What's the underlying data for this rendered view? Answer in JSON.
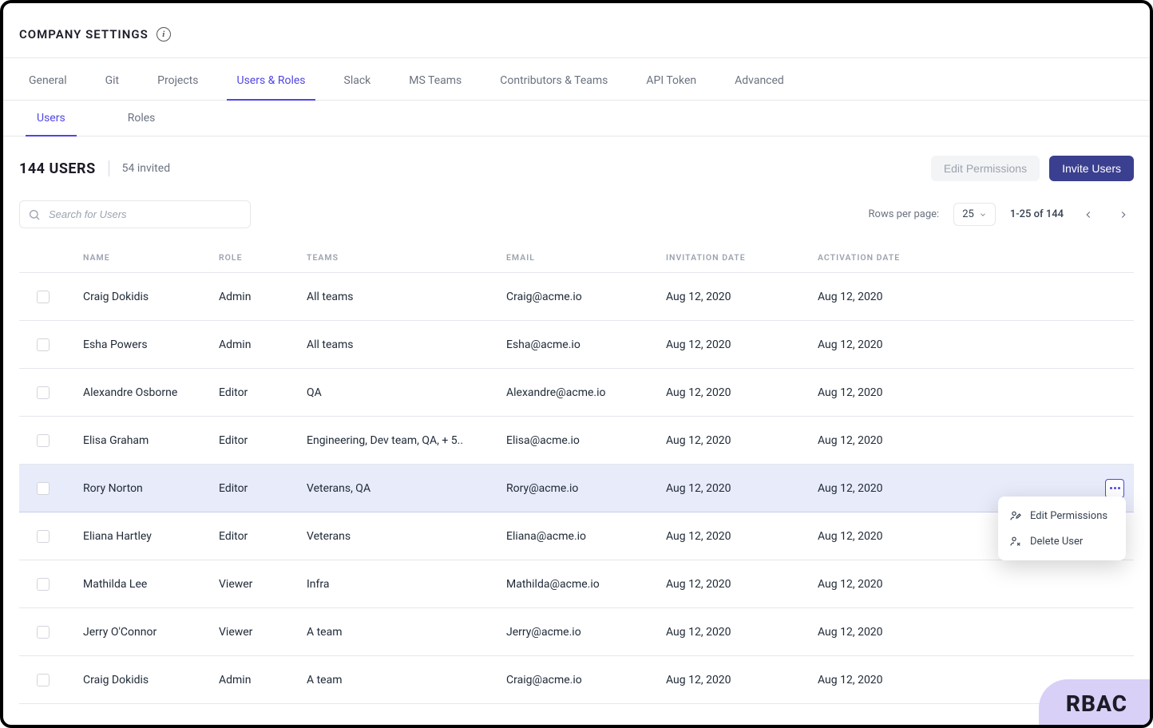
{
  "header": {
    "title": "COMPANY SETTINGS"
  },
  "tabs": {
    "items": [
      "General",
      "Git",
      "Projects",
      "Users & Roles",
      "Slack",
      "MS Teams",
      "Contributors & Teams",
      "API Token",
      "Advanced"
    ],
    "active_index": 3
  },
  "subtabs": {
    "items": [
      "Users",
      "Roles"
    ],
    "active_index": 0
  },
  "counts": {
    "main_number": "144",
    "main_label": "USERS",
    "invited": "54 invited"
  },
  "buttons": {
    "edit": "Edit Permissions",
    "invite": "Invite Users"
  },
  "search": {
    "placeholder": "Search for Users"
  },
  "pagination": {
    "rpp_label": "Rows per page:",
    "rpp_value": "25",
    "range": "1-25 of 144"
  },
  "columns": [
    "NAME",
    "ROLE",
    "TEAMS",
    "EMAIL",
    "INVITATION DATE",
    "ACTIVATION DATE"
  ],
  "rows": [
    {
      "name": "Craig Dokidis",
      "role": "Admin",
      "teams": "All teams",
      "email": "Craig@acme.io",
      "invite": "Aug 12, 2020",
      "activate": "Aug 12, 2020"
    },
    {
      "name": "Esha Powers",
      "role": "Admin",
      "teams": "All teams",
      "email": "Esha@acme.io",
      "invite": "Aug 12, 2020",
      "activate": "Aug 12, 2020"
    },
    {
      "name": "Alexandre Osborne",
      "role": "Editor",
      "teams": "QA",
      "email": "Alexandre@acme.io",
      "invite": "Aug 12, 2020",
      "activate": "Aug 12, 2020"
    },
    {
      "name": "Elisa Graham",
      "role": "Editor",
      "teams": "Engineering, Dev team, QA, + 5..",
      "email": "Elisa@acme.io",
      "invite": "Aug 12, 2020",
      "activate": "Aug 12, 2020"
    },
    {
      "name": "Rory Norton",
      "role": "Editor",
      "teams": "Veterans, QA",
      "email": "Rory@acme.io",
      "invite": "Aug 12, 2020",
      "activate": "Aug 12, 2020"
    },
    {
      "name": "Eliana Hartley",
      "role": "Editor",
      "teams": "Veterans",
      "email": "Eliana@acme.io",
      "invite": "Aug 12, 2020",
      "activate": "Aug 12, 2020"
    },
    {
      "name": "Mathilda Lee",
      "role": "Viewer",
      "teams": "Infra",
      "email": "Mathilda@acme.io",
      "invite": "Aug 12, 2020",
      "activate": "Aug 12, 2020"
    },
    {
      "name": "Jerry O'Connor",
      "role": "Viewer",
      "teams": "A team",
      "email": "Jerry@acme.io",
      "invite": "Aug 12, 2020",
      "activate": "Aug 12, 2020"
    },
    {
      "name": "Craig Dokidis",
      "role": "Admin",
      "teams": "A team",
      "email": "Craig@acme.io",
      "invite": "Aug 12, 2020",
      "activate": "Aug 12, 2020"
    }
  ],
  "hover_row_index": 4,
  "popup": {
    "edit": "Edit Permissions",
    "delete": "Delete User"
  },
  "badge": "RBAC"
}
